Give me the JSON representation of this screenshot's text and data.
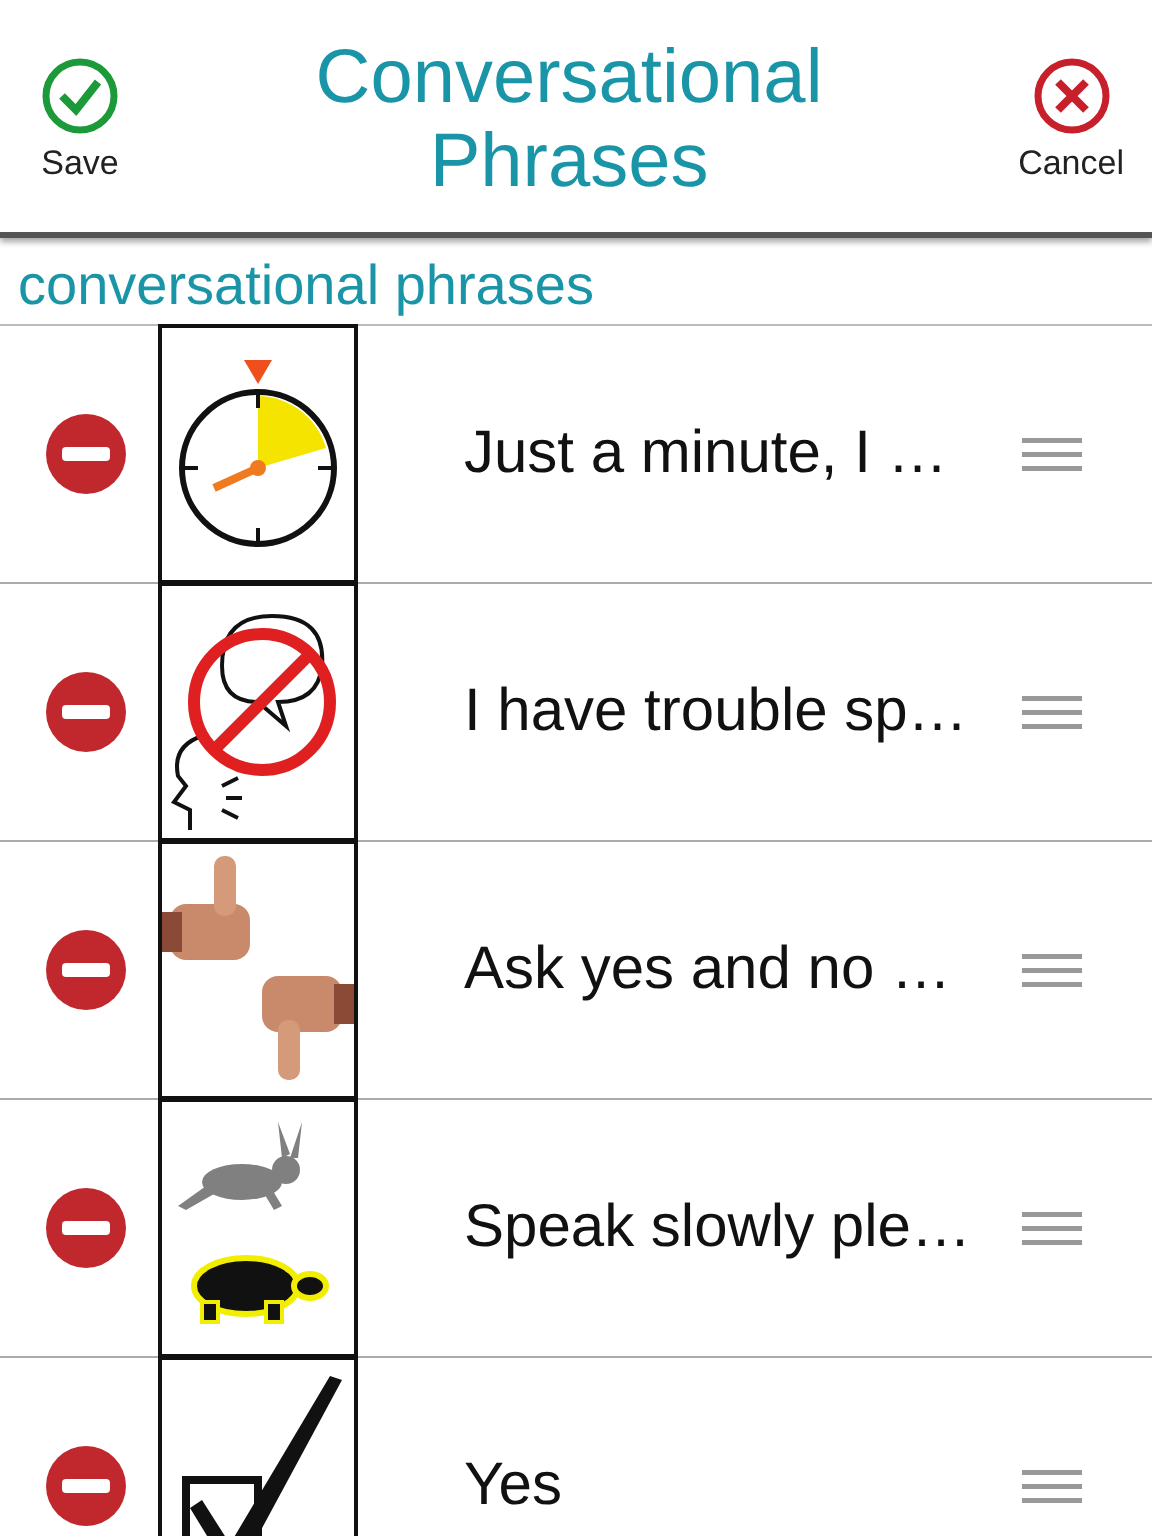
{
  "header": {
    "save": "Save",
    "title": "Conversational Phrases",
    "cancel": "Cancel"
  },
  "section": "conversational phrases",
  "rows": [
    {
      "kind": "timer",
      "text": "Just a minute, I …"
    },
    {
      "kind": "no-talking",
      "text": "I have trouble sp…"
    },
    {
      "kind": "thumbs",
      "text": "Ask yes and no …"
    },
    {
      "kind": "rabbit-turtle",
      "text": "Speak slowly ple…"
    },
    {
      "kind": "check",
      "text": "Yes"
    }
  ]
}
